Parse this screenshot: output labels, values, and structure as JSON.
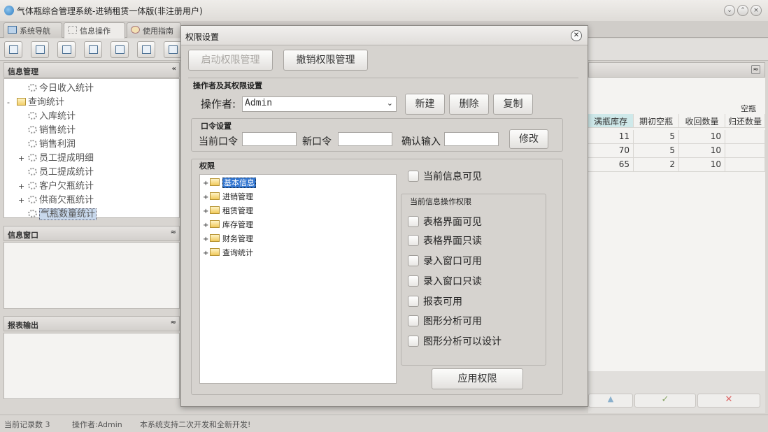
{
  "app": {
    "title": "气体瓶综合管理系统-进销租赁一体版(非注册用户)"
  },
  "tabs": [
    {
      "label": "系统导航"
    },
    {
      "label": "信息操作"
    },
    {
      "label": "使用指南"
    }
  ],
  "left": {
    "info_panel": {
      "title": "信息管理"
    },
    "tree": [
      {
        "label": "今日收入统计",
        "level": 2,
        "toggle": "",
        "icon": "gear-icon"
      },
      {
        "label": "查询统计",
        "level": 1,
        "toggle": "-",
        "icon": "folder-icon"
      },
      {
        "label": "入库统计",
        "level": 2,
        "toggle": "",
        "icon": "gear-icon"
      },
      {
        "label": "销售统计",
        "level": 2,
        "toggle": "",
        "icon": "gear-icon"
      },
      {
        "label": "销售利润",
        "level": 2,
        "toggle": "",
        "icon": "gear-icon"
      },
      {
        "label": "员工提成明细",
        "level": 2,
        "toggle": "+",
        "icon": "gear-icon"
      },
      {
        "label": "员工提成统计",
        "level": 2,
        "toggle": "",
        "icon": "gear-icon"
      },
      {
        "label": "客户欠瓶统计",
        "level": 2,
        "toggle": "+",
        "icon": "gear-icon"
      },
      {
        "label": "供商欠瓶统计",
        "level": 2,
        "toggle": "+",
        "icon": "gear-icon"
      },
      {
        "label": "气瓶数量统计",
        "level": 2,
        "toggle": "",
        "icon": "gear-icon",
        "selected": true
      }
    ],
    "window_panel": {
      "title": "信息窗口"
    },
    "report_panel": {
      "title": "报表输出"
    }
  },
  "right_grid": {
    "group_header": "空瓶",
    "columns": [
      "满瓶库存",
      "期初空瓶",
      "收回数量",
      "归还数量"
    ],
    "rows": [
      [
        "11",
        "5",
        "10",
        ""
      ],
      [
        "70",
        "5",
        "10",
        ""
      ],
      [
        "65",
        "2",
        "10",
        ""
      ]
    ]
  },
  "status": {
    "records": "当前记录数 3",
    "operator": "操作者:Admin",
    "note": "本系统支持二次开发和全新开发!"
  },
  "dialog": {
    "title": "权限设置",
    "enable_btn": "启动权限管理",
    "revoke_btn": "撤销权限管理",
    "operator_group": {
      "title": "操作者及其权限设置",
      "operator_label": "操作者:",
      "operator_value": "Admin",
      "new_btn": "新建",
      "delete_btn": "删除",
      "copy_btn": "复制"
    },
    "password_group": {
      "title": "口令设置",
      "current_label": "当前口令",
      "new_label": "新口令",
      "confirm_label": "确认输入",
      "modify_btn": "修改"
    },
    "perm_group": {
      "title": "权限"
    },
    "perm_tree": [
      {
        "label": "基本信息",
        "selected": true
      },
      {
        "label": "进销管理"
      },
      {
        "label": "租赁管理"
      },
      {
        "label": "库存管理"
      },
      {
        "label": "财务管理"
      },
      {
        "label": "查询统计"
      }
    ],
    "current_visible": "当前信息可见",
    "ops_group": {
      "title": "当前信息操作权限",
      "items": [
        "表格界面可见",
        "表格界面只读",
        "录入窗口可用",
        "录入窗口只读",
        "报表可用",
        "图形分析可用",
        "图形分析可以设计"
      ]
    },
    "apply_btn": "应用权限"
  }
}
